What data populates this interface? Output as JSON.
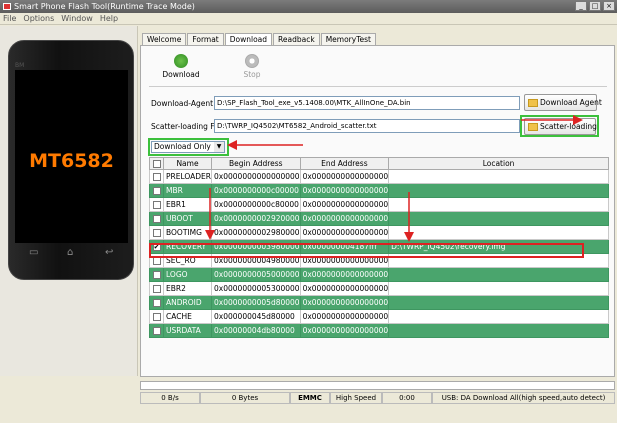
{
  "window": {
    "title": "Smart Phone Flash Tool(Runtime Trace Mode)",
    "controls": [
      "_",
      "□",
      "×"
    ]
  },
  "menu": [
    "File",
    "Options",
    "Window",
    "Help"
  ],
  "phone": {
    "brand": "BM",
    "chip": "MT6582",
    "buttons": [
      "▭",
      "⌂",
      "↩"
    ]
  },
  "tabs": [
    {
      "label": "Welcome",
      "active": false
    },
    {
      "label": "Format",
      "active": false
    },
    {
      "label": "Download",
      "active": true
    },
    {
      "label": "Readback",
      "active": false
    },
    {
      "label": "MemoryTest",
      "active": false
    }
  ],
  "toolbar": {
    "download_label": "Download",
    "stop_label": "Stop"
  },
  "download_agent": {
    "label": "Download-Agent",
    "path": "D:\\SP_Flash_Tool_exe_v5.1408.00\\MTK_AllInOne_DA.bin",
    "button": "Download Agent"
  },
  "scatter": {
    "label": "Scatter-loading File",
    "path": "D:\\TWRP_IQ4502\\MT6582_Android_scatter.txt",
    "button": "Scatter-loading"
  },
  "mode": {
    "selected": "Download Only"
  },
  "table": {
    "headers": [
      "Name",
      "Begin Address",
      "End Address",
      "Location"
    ],
    "rows": [
      {
        "checked": false,
        "name": "PRELOADER",
        "begin": "0x0000000000000000",
        "end": "0x0000000000000000",
        "location": ""
      },
      {
        "checked": false,
        "name": "MBR",
        "begin": "0x0000000000c00000",
        "end": "0x0000000000000000",
        "location": ""
      },
      {
        "checked": false,
        "name": "EBR1",
        "begin": "0x0000000000c80000",
        "end": "0x0000000000000000",
        "location": ""
      },
      {
        "checked": false,
        "name": "UBOOT",
        "begin": "0x0000000002920000",
        "end": "0x0000000000000000",
        "location": ""
      },
      {
        "checked": false,
        "name": "BOOTIMG",
        "begin": "0x0000000002980000",
        "end": "0x0000000000000000",
        "location": ""
      },
      {
        "checked": true,
        "name": "RECOVERY",
        "begin": "0x0000000003980000",
        "end": "0x000000004187fff",
        "location": "D:\\TWRP_IQ4502\\recovery.img"
      },
      {
        "checked": false,
        "name": "SEC_RO",
        "begin": "0x0000000004980000",
        "end": "0x0000000000000000",
        "location": ""
      },
      {
        "checked": false,
        "name": "LOGO",
        "begin": "0x0000000005000000",
        "end": "0x0000000000000000",
        "location": ""
      },
      {
        "checked": false,
        "name": "EBR2",
        "begin": "0x0000000005300000",
        "end": "0x0000000000000000",
        "location": ""
      },
      {
        "checked": false,
        "name": "ANDROID",
        "begin": "0x0000000005d80000",
        "end": "0x0000000000000000",
        "location": ""
      },
      {
        "checked": false,
        "name": "CACHE",
        "begin": "0x000000045d80000",
        "end": "0x0000000000000000",
        "location": ""
      },
      {
        "checked": false,
        "name": "USRDATA",
        "begin": "0x00000004db80000",
        "end": "0x0000000000000000",
        "location": ""
      }
    ]
  },
  "status": {
    "progress": 0.0,
    "speed": "0 B/s",
    "bytes": "0 Bytes",
    "storage": "EMMC",
    "usb_speed": "High Speed",
    "time": "0:00",
    "message": "USB: DA Download All(high speed,auto detect)"
  },
  "colors": {
    "row_green": "#4aa56d",
    "highlight_green": "#3cc03c",
    "highlight_red": "#d22222",
    "chip_orange": "#ff7a00"
  }
}
